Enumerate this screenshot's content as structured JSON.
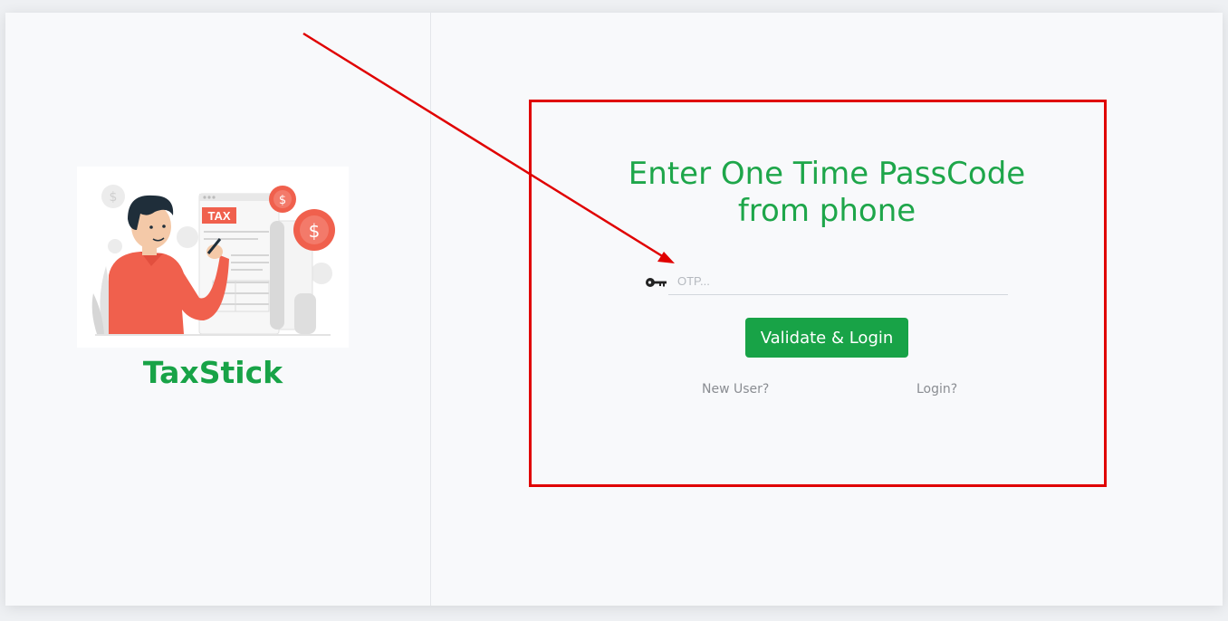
{
  "brand": {
    "name": "TaxStick"
  },
  "illustration": {
    "badge_text": "TAX",
    "coin_symbol": "$"
  },
  "otp_form": {
    "title_line1": "Enter One Time PassCode",
    "title_line2": "from phone",
    "otp_placeholder": "OTP...",
    "otp_value": "",
    "submit_label": "Validate & Login",
    "new_user_link": "New User?",
    "login_link": "Login?"
  },
  "colors": {
    "accent": "#18a347",
    "annotation": "#e00000"
  },
  "icons": {
    "otp_field": "key-icon"
  }
}
